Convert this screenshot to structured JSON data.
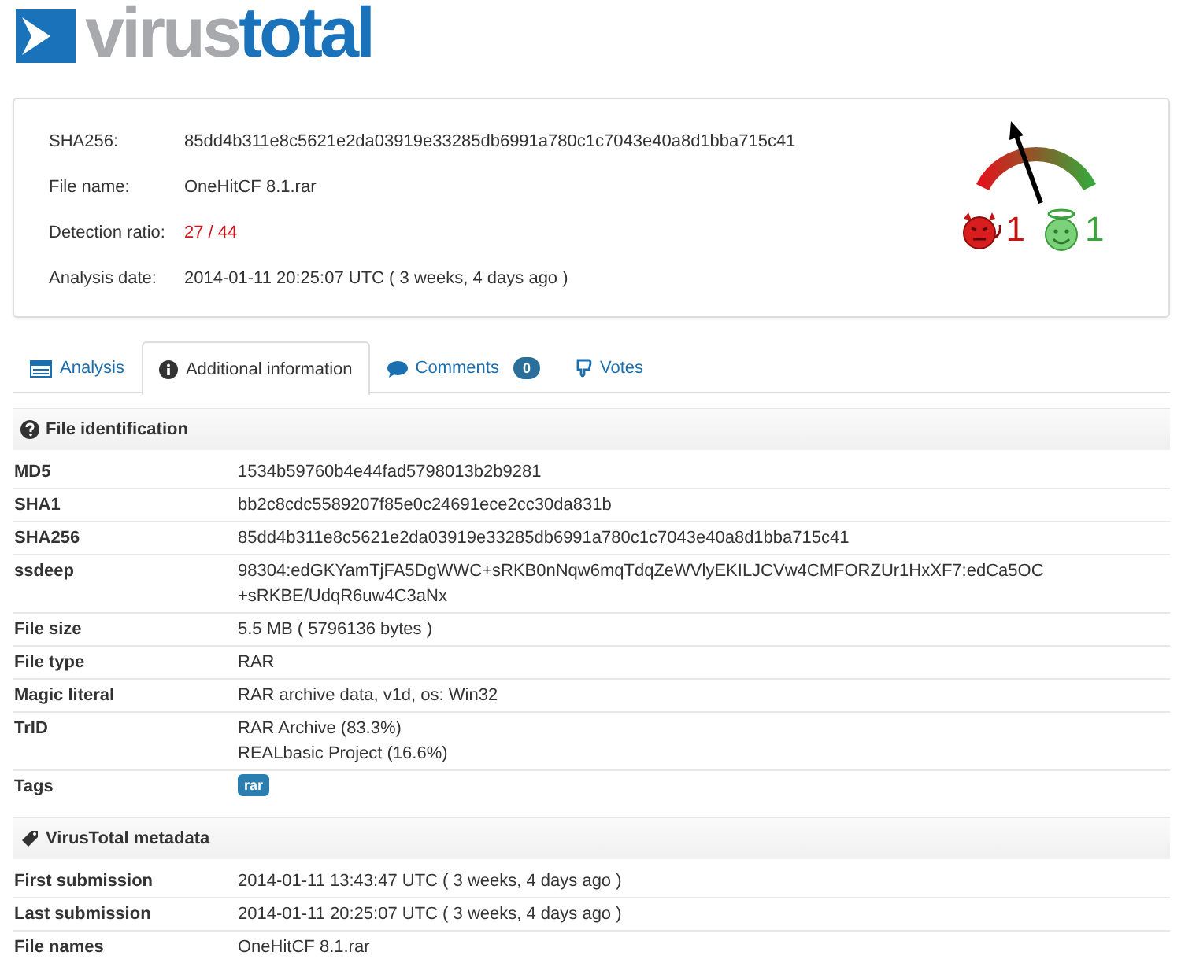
{
  "logo": {
    "part1": "virus",
    "part2": "total"
  },
  "summary": {
    "fields": [
      {
        "label": "SHA256:",
        "value": "85dd4b311e8c5621e2da03919e33285db6991a780c1c7043e40a8d1bba715c41",
        "kind": "plain"
      },
      {
        "label": "File name:",
        "value": "OneHitCF 8.1.rar",
        "kind": "plain"
      },
      {
        "label": "Detection ratio:",
        "value": "27 / 44",
        "kind": "alert"
      },
      {
        "label": "Analysis date:",
        "value": "2014-01-11 20:25:07 UTC ( 3 weeks, 4 days ago )",
        "kind": "plain"
      }
    ],
    "votes": {
      "malicious": "1",
      "harmless": "1"
    }
  },
  "tabs": [
    {
      "label": "Analysis",
      "kind": "analysis",
      "selected": false
    },
    {
      "label": "Additional information",
      "kind": "info",
      "selected": true
    },
    {
      "label": "Comments",
      "kind": "comments",
      "badge": "0",
      "selected": false
    },
    {
      "label": "Votes",
      "kind": "votes",
      "selected": false
    }
  ],
  "sections": [
    {
      "title": "File identification",
      "kind": "identification",
      "rows": [
        {
          "label": "MD5",
          "kind": "text",
          "lines": [
            "1534b59760b4e44fad5798013b2b9281"
          ]
        },
        {
          "label": "SHA1",
          "kind": "text",
          "lines": [
            "bb2c8cdc5589207f85e0c24691ece2cc30da831b"
          ]
        },
        {
          "label": "SHA256",
          "kind": "text",
          "lines": [
            "85dd4b311e8c5621e2da03919e33285db6991a780c1c7043e40a8d1bba715c41"
          ]
        },
        {
          "label": "ssdeep",
          "kind": "text",
          "lines": [
            "98304:edGKYamTjFA5DgWWC+sRKB0nNqw6mqTdqZeWVlyEKILJCVw4CMFORZUr1HxXF7:edCa5OC",
            "+sRKBE/UdqR6uw4C3aNx"
          ]
        },
        {
          "label": "File size",
          "kind": "text",
          "lines": [
            "5.5 MB ( 5796136 bytes )"
          ]
        },
        {
          "label": "File type",
          "kind": "text",
          "lines": [
            "RAR"
          ]
        },
        {
          "label": "Magic literal",
          "kind": "text",
          "lines": [
            "RAR archive data, v1d, os: Win32"
          ]
        },
        {
          "label": "TrID",
          "kind": "text",
          "lines": [
            "RAR Archive (83.3%)",
            "REALbasic Project (16.6%)"
          ]
        },
        {
          "label": "Tags",
          "kind": "tags",
          "lines": [
            "rar"
          ]
        }
      ]
    },
    {
      "title": "VirusTotal metadata",
      "kind": "metadata",
      "rows": [
        {
          "label": "First submission",
          "kind": "text",
          "lines": [
            "2014-01-11 13:43:47 UTC ( 3 weeks, 4 days ago )"
          ]
        },
        {
          "label": "Last submission",
          "kind": "text",
          "lines": [
            "2014-01-11 20:25:07 UTC ( 3 weeks, 4 days ago )"
          ]
        },
        {
          "label": "File names",
          "kind": "text",
          "lines": [
            "OneHitCF 8.1.rar"
          ]
        }
      ]
    }
  ]
}
